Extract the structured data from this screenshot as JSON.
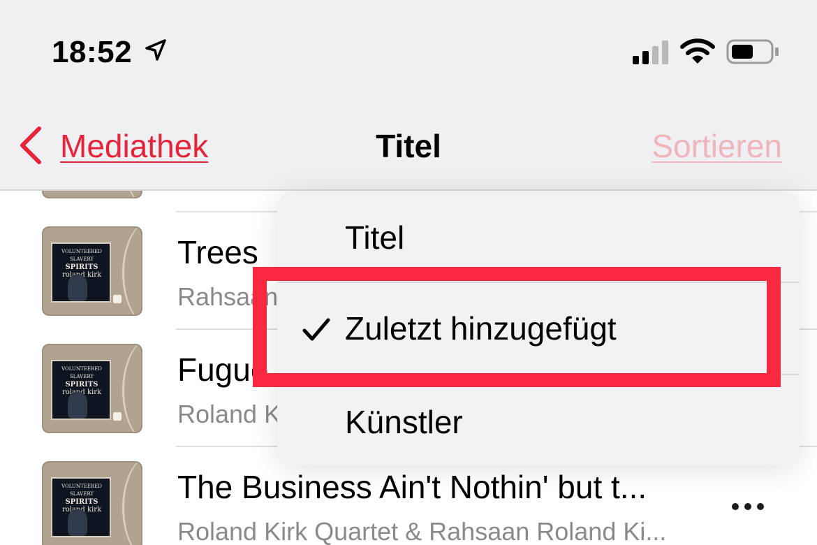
{
  "status_bar": {
    "time": "18:52",
    "icons": [
      "location-arrow-icon",
      "cellular-signal-icon",
      "wifi-icon",
      "battery-icon"
    ]
  },
  "nav": {
    "back_label": "Mediathek",
    "title": "Titel",
    "sort_label": "Sortieren"
  },
  "songs": [
    {
      "title": "Trees",
      "artist": "Rahsaan Roland Kirk"
    },
    {
      "title": "Fugue",
      "artist": "Roland Kirk"
    },
    {
      "title": "The Business Ain't Nothin' but t...",
      "artist": "Roland Kirk Quartet & Rahsaan Roland Ki..."
    }
  ],
  "album_art": {
    "line1": "VOLUNTEERED SLAVERY",
    "line2": "SPIRITS",
    "line3": "roland kirk"
  },
  "sort_menu": {
    "items": [
      {
        "label": "Titel",
        "checked": false
      },
      {
        "label": "Zuletzt hinzugefügt",
        "checked": true
      },
      {
        "label": "Künstler",
        "checked": false
      }
    ]
  },
  "colors": {
    "accent": "#e5233a",
    "sort_disabled": "#f0b4bb",
    "highlight": "#f7283f",
    "secondary_text": "#8a8a8e"
  }
}
